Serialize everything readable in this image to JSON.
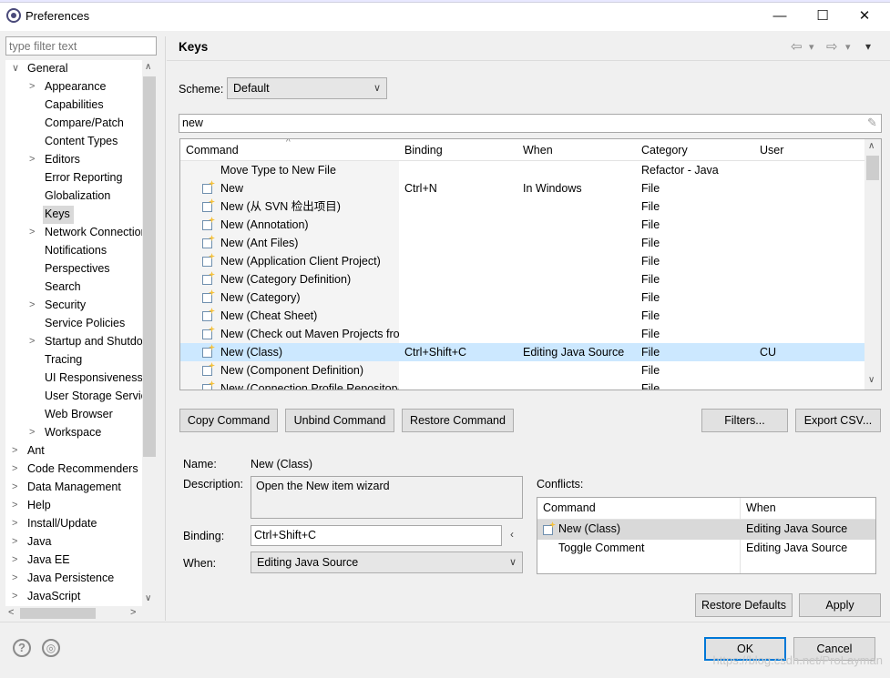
{
  "window": {
    "title": "Preferences",
    "minimize": "—",
    "maximize": "☐",
    "close": "✕"
  },
  "filter": {
    "placeholder": "type filter text"
  },
  "tree": {
    "items": [
      {
        "label": "General",
        "arrow": "∨"
      },
      {
        "label": "Appearance",
        "arrow": ">"
      },
      {
        "label": "Capabilities",
        "arrow": ""
      },
      {
        "label": "Compare/Patch",
        "arrow": ""
      },
      {
        "label": "Content Types",
        "arrow": ""
      },
      {
        "label": "Editors",
        "arrow": ">"
      },
      {
        "label": "Error Reporting",
        "arrow": ""
      },
      {
        "label": "Globalization",
        "arrow": ""
      },
      {
        "label": "Keys",
        "arrow": ""
      },
      {
        "label": "Network Connections",
        "arrow": ">"
      },
      {
        "label": "Notifications",
        "arrow": ""
      },
      {
        "label": "Perspectives",
        "arrow": ""
      },
      {
        "label": "Search",
        "arrow": ""
      },
      {
        "label": "Security",
        "arrow": ">"
      },
      {
        "label": "Service Policies",
        "arrow": ""
      },
      {
        "label": "Startup and Shutdown",
        "arrow": ">"
      },
      {
        "label": "Tracing",
        "arrow": ""
      },
      {
        "label": "UI Responsiveness",
        "arrow": ""
      },
      {
        "label": "User Storage Service",
        "arrow": ""
      },
      {
        "label": "Web Browser",
        "arrow": ""
      },
      {
        "label": "Workspace",
        "arrow": ">"
      },
      {
        "label": "Ant",
        "arrow": ">"
      },
      {
        "label": "Code Recommenders",
        "arrow": ">"
      },
      {
        "label": "Data Management",
        "arrow": ">"
      },
      {
        "label": "Help",
        "arrow": ">"
      },
      {
        "label": "Install/Update",
        "arrow": ">"
      },
      {
        "label": "Java",
        "arrow": ">"
      },
      {
        "label": "Java EE",
        "arrow": ">"
      },
      {
        "label": "Java Persistence",
        "arrow": ">"
      },
      {
        "label": "JavaScript",
        "arrow": ">"
      }
    ]
  },
  "page": {
    "title": "Keys",
    "back_icon": "⇦",
    "forward_icon": "⇨",
    "menu_icon": "▾"
  },
  "scheme": {
    "label": "Scheme:",
    "value": "Default"
  },
  "search": {
    "value": "new"
  },
  "grid": {
    "headers": {
      "command": "Command",
      "binding": "Binding",
      "when": "When",
      "category": "Category",
      "user": "User"
    },
    "sort_icon": "^",
    "rows": [
      {
        "command": "Move Type to New File",
        "binding": "",
        "when": "",
        "category": "Refactor - Java",
        "user": ""
      },
      {
        "command": "New",
        "binding": "Ctrl+N",
        "when": "In Windows",
        "category": "File",
        "user": ""
      },
      {
        "command": "New (从 SVN 检出项目)",
        "binding": "",
        "when": "",
        "category": "File",
        "user": ""
      },
      {
        "command": "New (Annotation)",
        "binding": "",
        "when": "",
        "category": "File",
        "user": ""
      },
      {
        "command": "New (Ant Files)",
        "binding": "",
        "when": "",
        "category": "File",
        "user": ""
      },
      {
        "command": "New (Application Client Project)",
        "binding": "",
        "when": "",
        "category": "File",
        "user": ""
      },
      {
        "command": "New (Category Definition)",
        "binding": "",
        "when": "",
        "category": "File",
        "user": ""
      },
      {
        "command": "New (Category)",
        "binding": "",
        "when": "",
        "category": "File",
        "user": ""
      },
      {
        "command": "New (Cheat Sheet)",
        "binding": "",
        "when": "",
        "category": "File",
        "user": ""
      },
      {
        "command": "New (Check out Maven Projects from SCM)",
        "binding": "",
        "when": "",
        "category": "File",
        "user": ""
      },
      {
        "command": "New (Class)",
        "binding": "Ctrl+Shift+C",
        "when": "Editing Java Source",
        "category": "File",
        "user": "CU"
      },
      {
        "command": "New (Component Definition)",
        "binding": "",
        "when": "",
        "category": "File",
        "user": ""
      },
      {
        "command": "New (Connection Profile Repository)",
        "binding": "",
        "when": "",
        "category": "File",
        "user": ""
      }
    ]
  },
  "buttons": {
    "copy": "Copy Command",
    "unbind": "Unbind Command",
    "restore": "Restore Command",
    "filters": "Filters...",
    "export": "Export CSV...",
    "restore_defaults": "Restore Defaults",
    "apply": "Apply",
    "ok": "OK",
    "cancel": "Cancel"
  },
  "details": {
    "name_label": "Name:",
    "name_value": "New (Class)",
    "description_label": "Description:",
    "description_value": "Open the New item wizard",
    "binding_label": "Binding:",
    "binding_value": "Ctrl+Shift+C",
    "when_label": "When:",
    "when_value": "Editing Java Source"
  },
  "conflicts": {
    "label": "Conflicts:",
    "headers": {
      "command": "Command",
      "when": "When"
    },
    "rows": [
      {
        "command": "New (Class)",
        "when": "Editing Java Source"
      },
      {
        "command": "Toggle Comment",
        "when": "Editing Java Source"
      }
    ]
  },
  "footer": {
    "help_icon": "?",
    "import_icon": "◎",
    "watermark": "https://blog.csdn.net/ProLayman"
  }
}
